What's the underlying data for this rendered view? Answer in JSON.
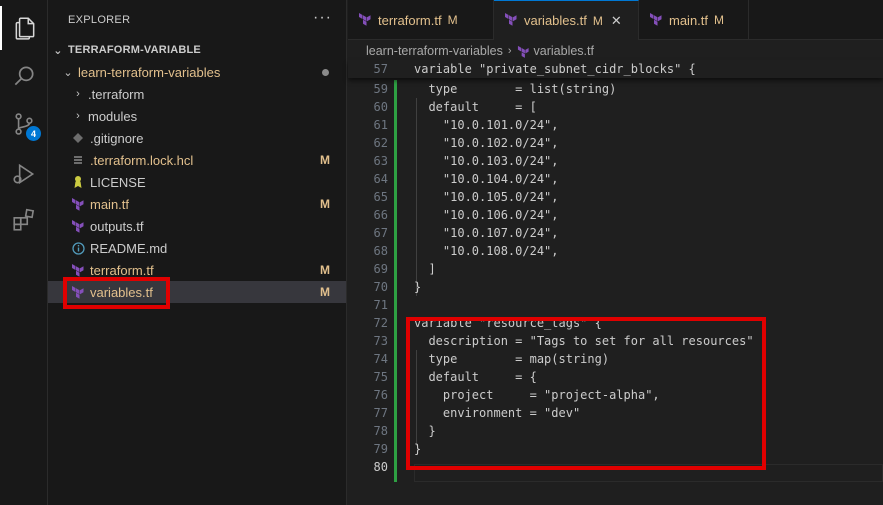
{
  "activity_bar": {
    "scm_badge": "4"
  },
  "sidebar": {
    "header": "EXPLORER",
    "more": "···",
    "root": "TERRAFORM-VARIABLE",
    "folder": "learn-terraform-variables",
    "items": [
      {
        "label": ".terraform",
        "status": "",
        "kind": "folder"
      },
      {
        "label": "modules",
        "status": "",
        "kind": "folder"
      },
      {
        "label": ".gitignore",
        "status": "",
        "kind": "gitignore"
      },
      {
        "label": ".terraform.lock.hcl",
        "status": "M",
        "kind": "lock"
      },
      {
        "label": "LICENSE",
        "status": "",
        "kind": "license"
      },
      {
        "label": "main.tf",
        "status": "M",
        "kind": "tf"
      },
      {
        "label": "outputs.tf",
        "status": "",
        "kind": "tf"
      },
      {
        "label": "README.md",
        "status": "",
        "kind": "info"
      },
      {
        "label": "terraform.tf",
        "status": "M",
        "kind": "tf"
      },
      {
        "label": "variables.tf",
        "status": "M",
        "kind": "tf"
      }
    ]
  },
  "tabs": [
    {
      "label": "terraform.tf",
      "status": "M"
    },
    {
      "label": "variables.tf",
      "status": "M",
      "close": "✕"
    },
    {
      "label": "main.tf",
      "status": "M"
    }
  ],
  "breadcrumb": {
    "folder": "learn-terraform-variables",
    "file": "variables.tf"
  },
  "code": {
    "sticky_line": {
      "n": "57",
      "text": "variable \"private_subnet_cidr_blocks\" {"
    },
    "lines": [
      {
        "n": "59",
        "text": "  type        = list(string)"
      },
      {
        "n": "60",
        "text": "  default     = ["
      },
      {
        "n": "61",
        "text": "    \"10.0.101.0/24\","
      },
      {
        "n": "62",
        "text": "    \"10.0.102.0/24\","
      },
      {
        "n": "63",
        "text": "    \"10.0.103.0/24\","
      },
      {
        "n": "64",
        "text": "    \"10.0.104.0/24\","
      },
      {
        "n": "65",
        "text": "    \"10.0.105.0/24\","
      },
      {
        "n": "66",
        "text": "    \"10.0.106.0/24\","
      },
      {
        "n": "67",
        "text": "    \"10.0.107.0/24\","
      },
      {
        "n": "68",
        "text": "    \"10.0.108.0/24\","
      },
      {
        "n": "69",
        "text": "  ]"
      },
      {
        "n": "70",
        "text": "}"
      },
      {
        "n": "71",
        "text": ""
      },
      {
        "n": "72",
        "text": "variable \"resource_tags\" {"
      },
      {
        "n": "73",
        "text": "  description = \"Tags to set for all resources\""
      },
      {
        "n": "74",
        "text": "  type        = map(string)"
      },
      {
        "n": "75",
        "text": "  default     = {"
      },
      {
        "n": "76",
        "text": "    project     = \"project-alpha\","
      },
      {
        "n": "77",
        "text": "    environment = \"dev\""
      },
      {
        "n": "78",
        "text": "  }"
      },
      {
        "n": "79",
        "text": "}"
      },
      {
        "n": "80",
        "text": ""
      }
    ]
  },
  "colors": {
    "accent": "#0078d4",
    "modified": "#e2c08d",
    "terraform_icon": "#844fba",
    "highlight_box": "#e00000",
    "added_gutter": "#2ea043"
  }
}
